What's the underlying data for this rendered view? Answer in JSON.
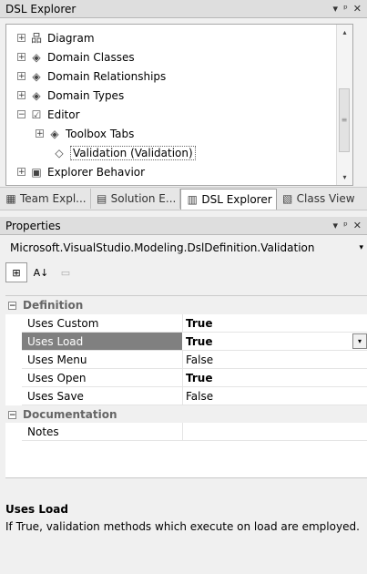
{
  "explorer": {
    "title": "DSL Explorer",
    "controls": [
      "▾",
      "ᵖ",
      "✕"
    ],
    "tree": [
      {
        "label": "Diagram",
        "expander": "+",
        "icon": "diagram-icon",
        "level": 1
      },
      {
        "label": "Domain Classes",
        "expander": "+",
        "icon": "domain-class-icon",
        "level": 1
      },
      {
        "label": "Domain Relationships",
        "expander": "+",
        "icon": "domain-relationship-icon",
        "level": 1
      },
      {
        "label": "Domain Types",
        "expander": "+",
        "icon": "domain-type-icon",
        "level": 1
      },
      {
        "label": "Editor",
        "expander": "−",
        "icon": "editor-icon",
        "level": 1
      },
      {
        "label": "Toolbox Tabs",
        "expander": "+",
        "icon": "toolbox-tabs-icon",
        "level": 2
      },
      {
        "label": "Validation (Validation)",
        "expander": "",
        "icon": "validation-icon",
        "level": 2,
        "selected": true
      },
      {
        "label": "Explorer Behavior",
        "expander": "+",
        "icon": "explorer-behavior-icon",
        "level": 1
      }
    ],
    "scroll_up": "▴",
    "scroll_down": "▾",
    "thumb_grip": "≡"
  },
  "tabs": [
    {
      "label": "Team Expl...",
      "icon": "team-explorer-icon"
    },
    {
      "label": "Solution E...",
      "icon": "solution-explorer-icon"
    },
    {
      "label": "DSL Explorer",
      "icon": "dsl-explorer-icon",
      "active": true
    },
    {
      "label": "Class View",
      "icon": "class-view-icon"
    }
  ],
  "properties": {
    "title": "Properties",
    "controls": [
      "▾",
      "ᵖ",
      "✕"
    ],
    "object_selector": "Microsoft.VisualStudio.Modeling.DslDefinition.Validation",
    "object_selector_arrow": "▾",
    "toolbar": {
      "categorized": "⊞",
      "alphabetical": "A↓",
      "property_pages": "▭"
    },
    "categories": [
      {
        "name": "Definition",
        "expander": "−",
        "rows": [
          {
            "name": "Uses Custom",
            "value": "True",
            "bold": true
          },
          {
            "name": "Uses Load",
            "value": "True",
            "bold": true,
            "selected": true,
            "dropdown": "▾"
          },
          {
            "name": "Uses Menu",
            "value": "False",
            "bold": false
          },
          {
            "name": "Uses Open",
            "value": "True",
            "bold": true
          },
          {
            "name": "Uses Save",
            "value": "False",
            "bold": false
          }
        ]
      },
      {
        "name": "Documentation",
        "expander": "−",
        "rows": [
          {
            "name": "Notes",
            "value": "",
            "bold": false
          }
        ]
      }
    ],
    "description": {
      "title": "Uses Load",
      "text": "If True, validation methods which execute on load are employed."
    }
  }
}
